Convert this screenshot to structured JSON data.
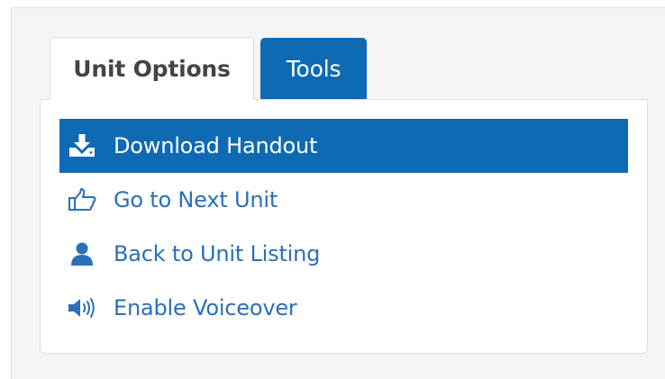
{
  "tabs": {
    "unit_options": "Unit Options",
    "tools": "Tools"
  },
  "menu": {
    "items": [
      {
        "label": "Download Handout",
        "icon": "download-icon",
        "active": true
      },
      {
        "label": "Go to Next Unit",
        "icon": "thumbs-up-icon",
        "active": false
      },
      {
        "label": "Back to Unit Listing",
        "icon": "user-icon",
        "active": false
      },
      {
        "label": "Enable Voiceover",
        "icon": "volume-icon",
        "active": false
      }
    ]
  },
  "colors": {
    "accent": "#0f6ab4",
    "link": "#2a6fb8",
    "tab_text": "#444444"
  }
}
